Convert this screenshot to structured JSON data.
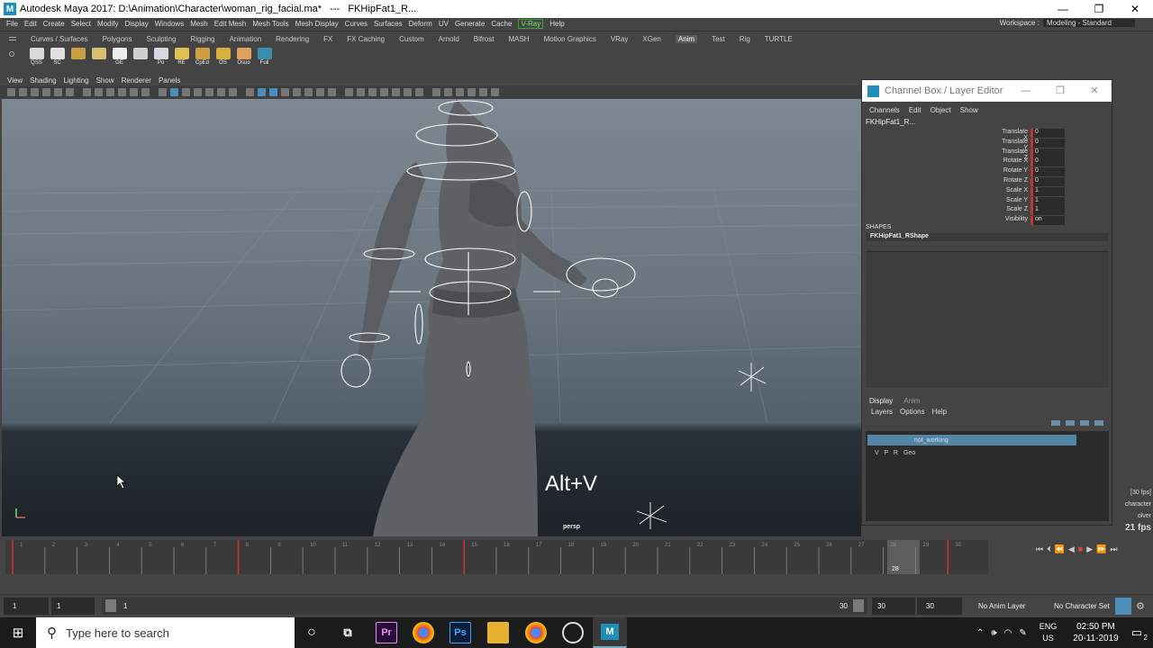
{
  "window": {
    "title": "Autodesk Maya 2017: D:\\Animation\\Character\\woman_rig_facial.ma*   ---   FKHipFat1_R...",
    "logo_letter": "M",
    "controls": [
      "—",
      "❐",
      "✕"
    ]
  },
  "menubar": {
    "items": [
      "File",
      "Edit",
      "Create",
      "Select",
      "Modify",
      "Display",
      "Windows",
      "Mesh",
      "Edit Mesh",
      "Mesh Tools",
      "Mesh Display",
      "Curves",
      "Surfaces",
      "Deform",
      "UV",
      "Generate",
      "Cache"
    ],
    "vray": "V-Ray",
    "help": "Help",
    "workspace_label": "Workspace :",
    "workspace_value": "Modeling - Standard"
  },
  "shelf": {
    "tabs": [
      "Curves / Surfaces",
      "Polygons",
      "Sculpting",
      "Rigging",
      "Animation",
      "Rendering",
      "FX",
      "FX Caching",
      "Custom",
      "Arnold",
      "Bifrost",
      "MASH",
      "Motion Graphics",
      "VRay",
      "XGen",
      "Anim",
      "Test",
      "Rig",
      "TURTLE"
    ],
    "active_tab": "Anim",
    "icons": [
      {
        "label": "QSS",
        "color": "#d9d9d9"
      },
      {
        "label": "SC",
        "color": "#e0e0e0"
      },
      {
        "label": "",
        "color": "#c8a040"
      },
      {
        "label": "",
        "color": "#d4c070"
      },
      {
        "label": "GE",
        "color": "#eeeeee"
      },
      {
        "label": "",
        "color": "#cfcfcf"
      },
      {
        "label": "Po",
        "color": "#d8d8e0"
      },
      {
        "label": "RE",
        "color": "#dfc050"
      },
      {
        "label": "CpEd",
        "color": "#d0a040"
      },
      {
        "label": "OS",
        "color": "#d8b040"
      },
      {
        "label": "Osuo",
        "color": "#e0a060"
      },
      {
        "label": "Full",
        "color": "#3a8fb0"
      }
    ]
  },
  "viewport": {
    "menu": [
      "View",
      "Shading",
      "Lighting",
      "Show",
      "Renderer",
      "Panels"
    ],
    "camera_label": "persp",
    "overlay_key": "Alt+V",
    "fps_rate": "[30 fps]",
    "fps_lines": [
      "character",
      "olver"
    ],
    "fps_value": "21 fps"
  },
  "channel_box": {
    "title": "Channel Box / Layer Editor",
    "menu": [
      "Channels",
      "Edit",
      "Object",
      "Show"
    ],
    "node": "FKHipFat1_R...",
    "channels": [
      {
        "name": "Translate X",
        "value": "0"
      },
      {
        "name": "Translate Y",
        "value": "0"
      },
      {
        "name": "Translate Z",
        "value": "0"
      },
      {
        "name": "Rotate X",
        "value": "0"
      },
      {
        "name": "Rotate Y",
        "value": "0"
      },
      {
        "name": "Rotate Z",
        "value": "0"
      },
      {
        "name": "Scale X",
        "value": "1"
      },
      {
        "name": "Scale Y",
        "value": "1"
      },
      {
        "name": "Scale Z",
        "value": "1"
      },
      {
        "name": "Visibility",
        "value": "on"
      }
    ],
    "shapes_label": "SHAPES",
    "shape_name": "FKHipFat1_RShape"
  },
  "layer_editor": {
    "tabs": [
      "Display",
      "Anim"
    ],
    "active_tab": "Display",
    "menu": [
      "Layers",
      "Options",
      "Help"
    ],
    "layers": [
      {
        "flags": "",
        "name": "not_working",
        "selected": true
      },
      {
        "flags": "V   P   R",
        "name": "Geo",
        "selected": false
      }
    ]
  },
  "timeline": {
    "ticks": [
      "1",
      "2",
      "3",
      "4",
      "5",
      "6",
      "7",
      "8",
      "9",
      "10",
      "11",
      "12",
      "13",
      "14",
      "15",
      "16",
      "17",
      "18",
      "19",
      "20",
      "21",
      "22",
      "23",
      "24",
      "25",
      "26",
      "27",
      "28",
      "29",
      "30"
    ],
    "start": 1,
    "end": 30,
    "current_frame": "28",
    "keyframes": [
      1,
      8,
      15,
      30
    ]
  },
  "range": {
    "start": "1",
    "start_inner": "1",
    "slider_start": "1",
    "slider_end": "30",
    "end_inner": "30",
    "end": "30",
    "anim_layer": "No Anim Layer",
    "char_set": "No Character Set"
  },
  "taskbar": {
    "search_placeholder": "Type here to search",
    "lang": [
      "ENG",
      "US"
    ],
    "time": "02:50 PM",
    "date": "20-11-2019",
    "notif_count": "2"
  }
}
